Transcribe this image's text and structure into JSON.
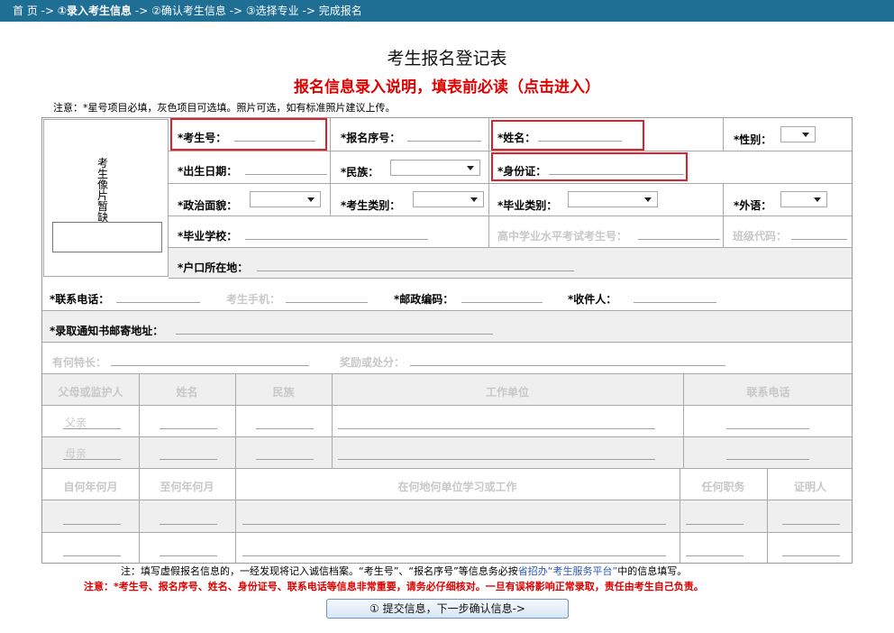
{
  "breadcrumb": {
    "home": "首 页",
    "sep": "->",
    "step1": "①录入考生信息",
    "step2": "②确认考生信息",
    "step3": "③选择专业",
    "step4": "完成报名"
  },
  "page_title": "考生报名登记表",
  "notice_link": "报名信息录入说明，填表前必读（点击进入）",
  "instructions": "注意：*星号项目必填，灰色项目可选填。照片可选，如有标准照片建议上传。",
  "photo_placeholder": "考生像片暂缺",
  "fields": {
    "exam_no": "*考生号：",
    "reg_no": "*报名序号：",
    "name": "*姓名：",
    "gender": "*性别：",
    "birth": "*出生日期：",
    "ethnicity": "*民族：",
    "id_card": "*身份证：",
    "politics": "*政治面貌：",
    "candidate_type": "*考生类别：",
    "grad_type": "*毕业类别：",
    "language": "*外语：",
    "school": "*毕业学校：",
    "hs_exam_no": "高中学业水平考试考生号：",
    "class_code": "班级代码：",
    "hukou": "*户口所在地：",
    "phone": "*联系电话：",
    "mobile": "考生手机：",
    "postcode": "*邮政编码：",
    "recipient": "*收件人：",
    "mail_address": "*录取通知书邮寄地址：",
    "specialty": "有何特长：",
    "awards": "奖励或处分："
  },
  "family_table": {
    "headers": [
      "父母或监护人",
      "姓名",
      "民族",
      "工作单位",
      "联系电话"
    ],
    "rows": [
      "父亲",
      "母亲"
    ]
  },
  "history_table": {
    "headers": [
      "自何年何月",
      "至何年何月",
      "在何地何单位学习或工作",
      "任何职务",
      "证明人"
    ]
  },
  "footer": {
    "note_prefix": "注：填写虚假报名信息的，一经发现将记入诚信档案。“考生号”、“报名序号”等信息务必按",
    "note_link": "省招办“考生服务平台”",
    "note_suffix": "中的信息填写。",
    "warning": "注意：*考生号、报名序号、姓名、身份证号、联系电话等信息非常重要，请务必仔细核对。一旦有误将影响正常录取，责任由考生自己负责。"
  },
  "submit_button": "① 提交信息，下一步确认信息->",
  "colors": {
    "topbar": "#1f6e94",
    "alert_red": "#e00000",
    "highlight_box": "#e0212b"
  }
}
